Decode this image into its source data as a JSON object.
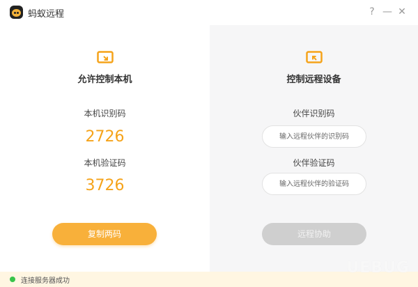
{
  "app": {
    "title": "蚂蚁远程",
    "help": "?",
    "minimize": "—",
    "close": "✕"
  },
  "left": {
    "title": "允许控制本机",
    "id_label": "本机识别码",
    "id_value": "2726",
    "code_label": "本机验证码",
    "code_value": "3726",
    "button": "复制两码"
  },
  "right": {
    "title": "控制远程设备",
    "partner_id_label": "伙伴识别码",
    "partner_id_placeholder": "输入远程伙伴的识别码",
    "partner_code_label": "伙伴验证码",
    "partner_code_placeholder": "输入远程伙伴的验证码",
    "button": "远程协助"
  },
  "status": {
    "text": "连接服务器成功",
    "color": "#39c44a"
  },
  "colors": {
    "accent": "#f8b03a",
    "code": "#f5a31a"
  },
  "watermark": "UEBUG"
}
